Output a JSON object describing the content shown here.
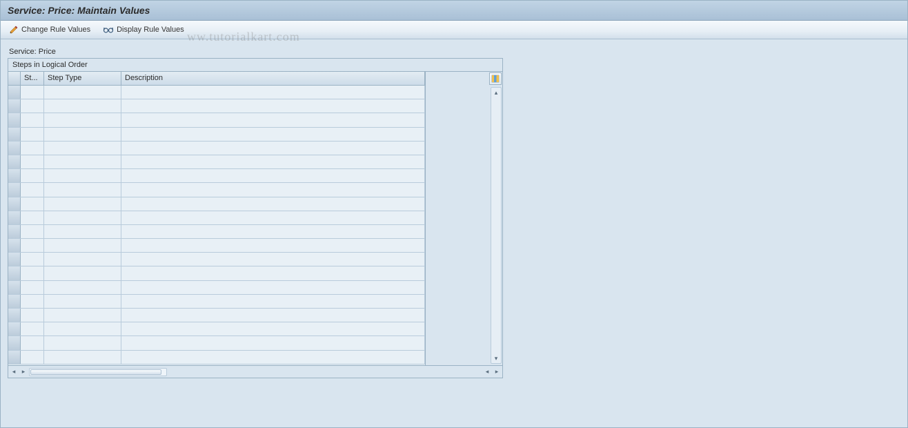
{
  "header": {
    "title": "Service: Price: Maintain Values"
  },
  "toolbar": {
    "change_label": "Change Rule Values",
    "display_label": "Display Rule Values"
  },
  "watermark": "ww.tutorialkart.com",
  "section": {
    "label": "Service: Price",
    "table_title": "Steps in Logical Order",
    "columns": {
      "st": "St...",
      "step_type": "Step Type",
      "description": "Description"
    },
    "rows": [
      {
        "st": "",
        "step_type": "",
        "description": ""
      },
      {
        "st": "",
        "step_type": "",
        "description": ""
      },
      {
        "st": "",
        "step_type": "",
        "description": ""
      },
      {
        "st": "",
        "step_type": "",
        "description": ""
      },
      {
        "st": "",
        "step_type": "",
        "description": ""
      },
      {
        "st": "",
        "step_type": "",
        "description": ""
      },
      {
        "st": "",
        "step_type": "",
        "description": ""
      },
      {
        "st": "",
        "step_type": "",
        "description": ""
      },
      {
        "st": "",
        "step_type": "",
        "description": ""
      },
      {
        "st": "",
        "step_type": "",
        "description": ""
      },
      {
        "st": "",
        "step_type": "",
        "description": ""
      },
      {
        "st": "",
        "step_type": "",
        "description": ""
      },
      {
        "st": "",
        "step_type": "",
        "description": ""
      },
      {
        "st": "",
        "step_type": "",
        "description": ""
      },
      {
        "st": "",
        "step_type": "",
        "description": ""
      },
      {
        "st": "",
        "step_type": "",
        "description": ""
      },
      {
        "st": "",
        "step_type": "",
        "description": ""
      },
      {
        "st": "",
        "step_type": "",
        "description": ""
      },
      {
        "st": "",
        "step_type": "",
        "description": ""
      },
      {
        "st": "",
        "step_type": "",
        "description": ""
      }
    ]
  }
}
